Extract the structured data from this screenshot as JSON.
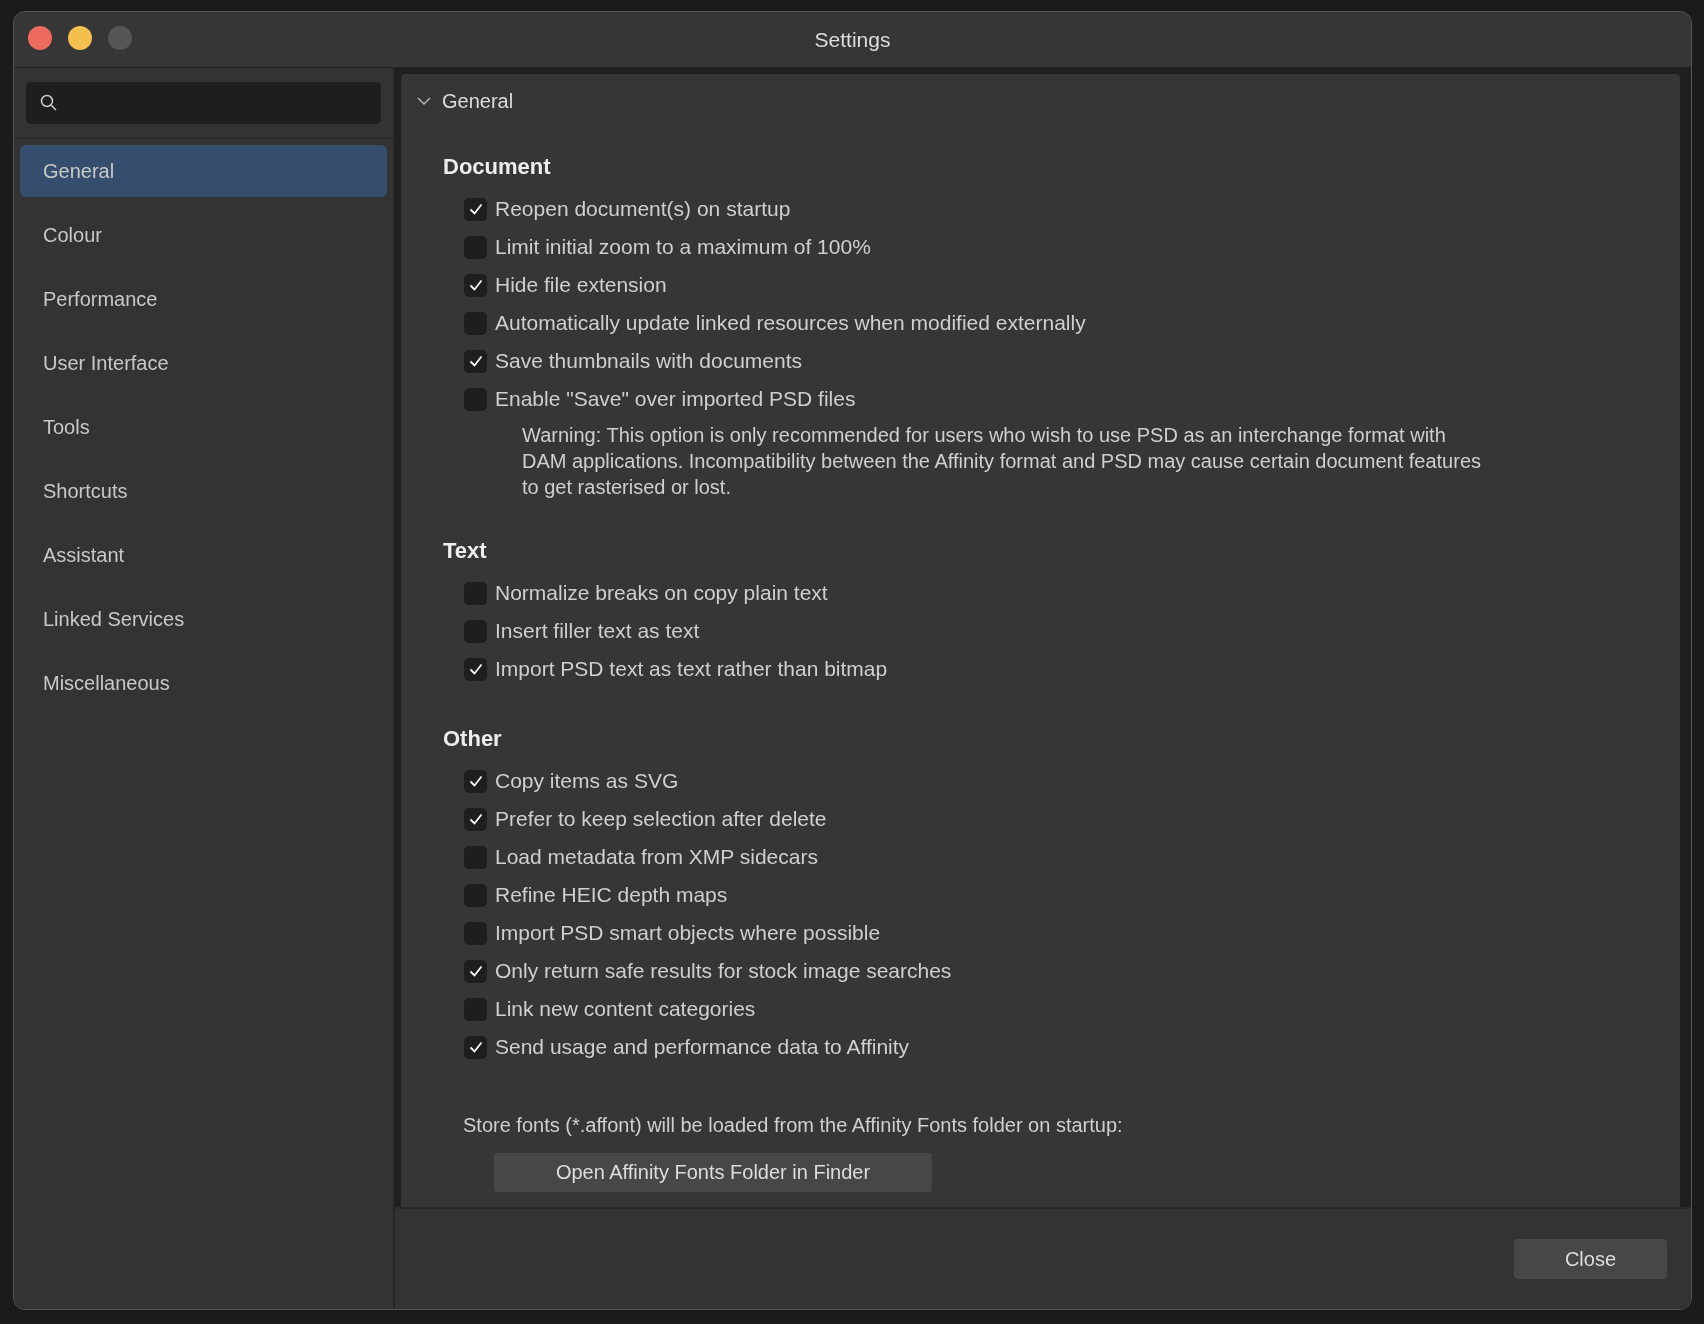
{
  "window": {
    "title": "Settings"
  },
  "sidebar": {
    "items": [
      {
        "label": "General",
        "selected": true
      },
      {
        "label": "Colour",
        "selected": false
      },
      {
        "label": "Performance",
        "selected": false
      },
      {
        "label": "User Interface",
        "selected": false
      },
      {
        "label": "Tools",
        "selected": false
      },
      {
        "label": "Shortcuts",
        "selected": false
      },
      {
        "label": "Assistant",
        "selected": false
      },
      {
        "label": "Linked Services",
        "selected": false
      },
      {
        "label": "Miscellaneous",
        "selected": false
      }
    ]
  },
  "panel": {
    "title": "General",
    "expanded": true,
    "sections": [
      {
        "heading": "Document",
        "options": [
          {
            "label": "Reopen document(s) on startup",
            "checked": true
          },
          {
            "label": "Limit initial zoom to a maximum of 100%",
            "checked": false
          },
          {
            "label": "Hide file extension",
            "checked": true
          },
          {
            "label": "Automatically update linked resources when modified externally",
            "checked": false
          },
          {
            "label": "Save thumbnails with documents",
            "checked": true
          },
          {
            "label": "Enable \"Save\" over imported PSD files",
            "checked": false,
            "note": "Warning: This option is only recommended for users who wish to use PSD as an interchange format with DAM applications. Incompatibility between the Affinity format and PSD may cause certain document features to get rasterised or lost."
          }
        ]
      },
      {
        "heading": "Text",
        "options": [
          {
            "label": "Normalize breaks on copy plain text",
            "checked": false
          },
          {
            "label": "Insert filler text as text",
            "checked": false
          },
          {
            "label": "Import PSD text as text rather than bitmap",
            "checked": true
          }
        ]
      },
      {
        "heading": "Other",
        "options": [
          {
            "label": "Copy items as SVG",
            "checked": true
          },
          {
            "label": "Prefer to keep selection after delete",
            "checked": true
          },
          {
            "label": "Load metadata from XMP sidecars",
            "checked": false
          },
          {
            "label": "Refine HEIC depth maps",
            "checked": false
          },
          {
            "label": "Import PSD smart objects where possible",
            "checked": false
          },
          {
            "label": "Only return safe results for stock image searches",
            "checked": true
          },
          {
            "label": "Link new content categories",
            "checked": false
          },
          {
            "label": "Send usage and performance data to Affinity",
            "checked": true
          }
        ]
      }
    ],
    "fonts_note": "Store fonts (*.affont) will be loaded from the Affinity Fonts folder on startup:",
    "fonts_button": "Open Affinity Fonts Folder in Finder"
  },
  "footer": {
    "close_button": "Close"
  }
}
